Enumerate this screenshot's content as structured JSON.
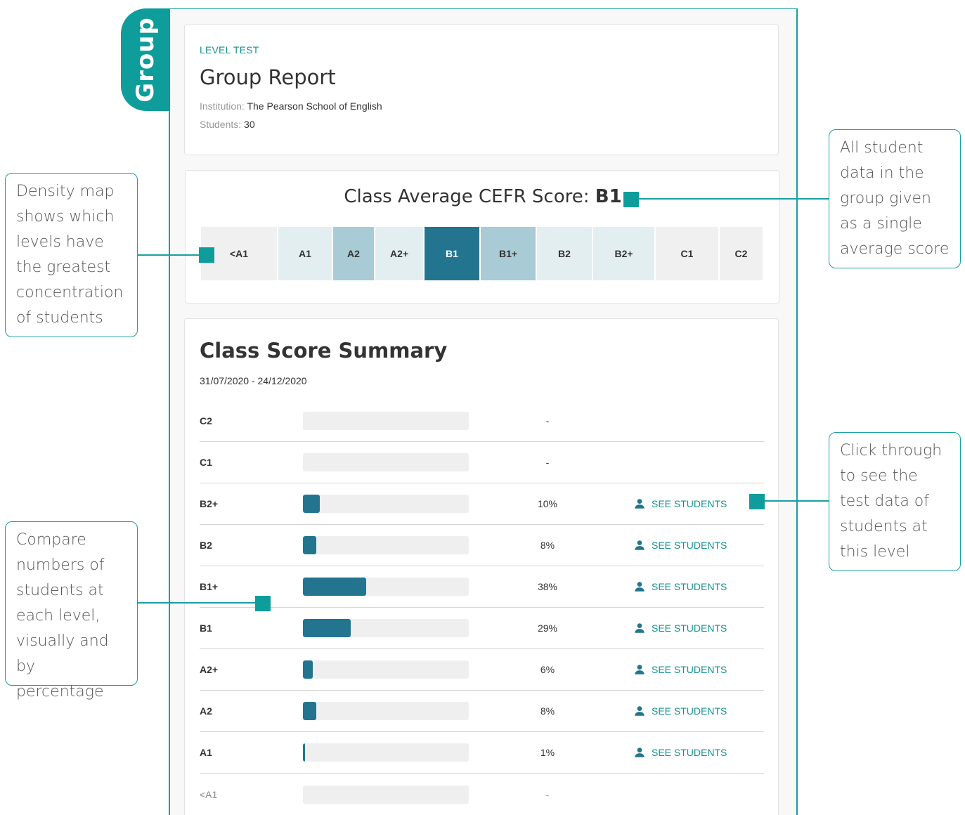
{
  "side_tab": "Group",
  "header": {
    "eyebrow": "LEVEL TEST",
    "title": "Group Report",
    "institution_label": "Institution:",
    "institution": "The Pearson School of English",
    "students_label": "Students:",
    "students": "30"
  },
  "average": {
    "title_prefix": "Class Average CEFR Score:",
    "score": "B1",
    "levels": [
      {
        "label": "<A1",
        "color": "#f0f0f0"
      },
      {
        "label": "A1",
        "color": "#e3eef1"
      },
      {
        "label": "A2",
        "color": "#a8cbd5"
      },
      {
        "label": "A2+",
        "color": "#e3eef1"
      },
      {
        "label": "B1",
        "color": "#23758f"
      },
      {
        "label": "B1+",
        "color": "#a8cbd5"
      },
      {
        "label": "B2",
        "color": "#e3eef1"
      },
      {
        "label": "B2+",
        "color": "#e3eef1"
      },
      {
        "label": "C1",
        "color": "#f0f0f0"
      },
      {
        "label": "C2",
        "color": "#f0f0f0"
      }
    ]
  },
  "summary": {
    "title": "Class Score Summary",
    "dates": "31/07/2020 - 24/12/2020",
    "link_label": "SEE STUDENTS",
    "rows": [
      {
        "level": "C2",
        "percent": "-",
        "fraction": 0
      },
      {
        "level": "C1",
        "percent": "-",
        "fraction": 0
      },
      {
        "level": "B2+",
        "percent": "10%",
        "fraction": 0.1
      },
      {
        "level": "B2",
        "percent": "8%",
        "fraction": 0.08
      },
      {
        "level": "B1+",
        "percent": "38%",
        "fraction": 0.38
      },
      {
        "level": "B1",
        "percent": "29%",
        "fraction": 0.29
      },
      {
        "level": "A2+",
        "percent": "6%",
        "fraction": 0.06
      },
      {
        "level": "A2",
        "percent": "8%",
        "fraction": 0.08
      },
      {
        "level": "A1",
        "percent": "1%",
        "fraction": 0.01
      },
      {
        "level": "<A1",
        "percent": "-",
        "fraction": 0
      }
    ]
  },
  "callouts": {
    "density": "Density map\nshows which\nlevels have\nthe greatest\nconcentration\nof students",
    "average": "All student\ndata in the\ngroup given\nas a single\naverage score",
    "click": "Click through\nto see the\ntest data of\nstudents at\nthis level",
    "compare": "Compare\nnumbers of\nstudents at\neach level,\nvisually and by\npercentage"
  },
  "colors": {
    "accent": "#0e9d9b",
    "bar": "#23758f",
    "link": "#12928f"
  }
}
